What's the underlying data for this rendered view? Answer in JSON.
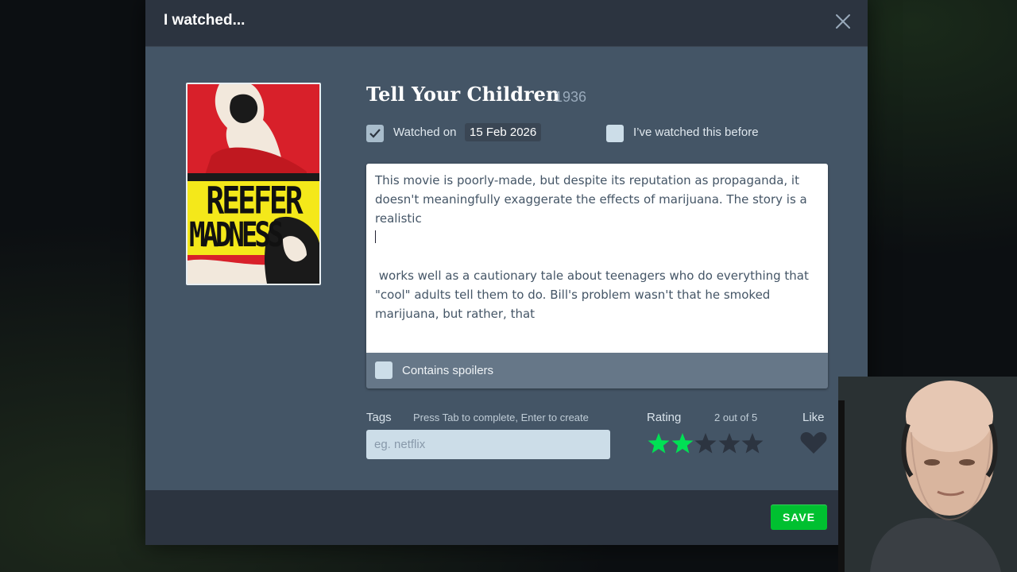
{
  "modal": {
    "title": "I watched...",
    "film": {
      "title": "Tell Your Children",
      "year": "1936"
    },
    "poster": {
      "line1": "REEFER",
      "line2": "MADNESS"
    },
    "watched": {
      "checked": true,
      "label": "Watched on",
      "date": "15 Feb 2026"
    },
    "rewatch": {
      "checked": false,
      "label": "I’ve watched this before"
    },
    "review": {
      "paragraph1": "This movie is poorly-made, but despite its reputation as propaganda, it doesn't meaningfully exaggerate the effects of marijuana. The story is a realistic",
      "paragraph2": " works well as a cautionary tale about teenagers who do everything that \"cool\" adults tell them to do. Bill's problem wasn't that he smoked marijuana, but rather, that"
    },
    "spoilers": {
      "checked": false,
      "label": "Contains spoilers"
    },
    "tags": {
      "label": "Tags",
      "hint": "Press Tab to complete, Enter to create",
      "placeholder": "eg. netflix",
      "value": ""
    },
    "rating": {
      "label": "Rating",
      "value_text": "2 out of 5",
      "value": 2,
      "max": 5
    },
    "like": {
      "label": "Like",
      "liked": false
    },
    "save_label": "SAVE"
  },
  "colors": {
    "accent": "#00c030",
    "star_on": "#00e054",
    "star_off": "#2c3440"
  }
}
